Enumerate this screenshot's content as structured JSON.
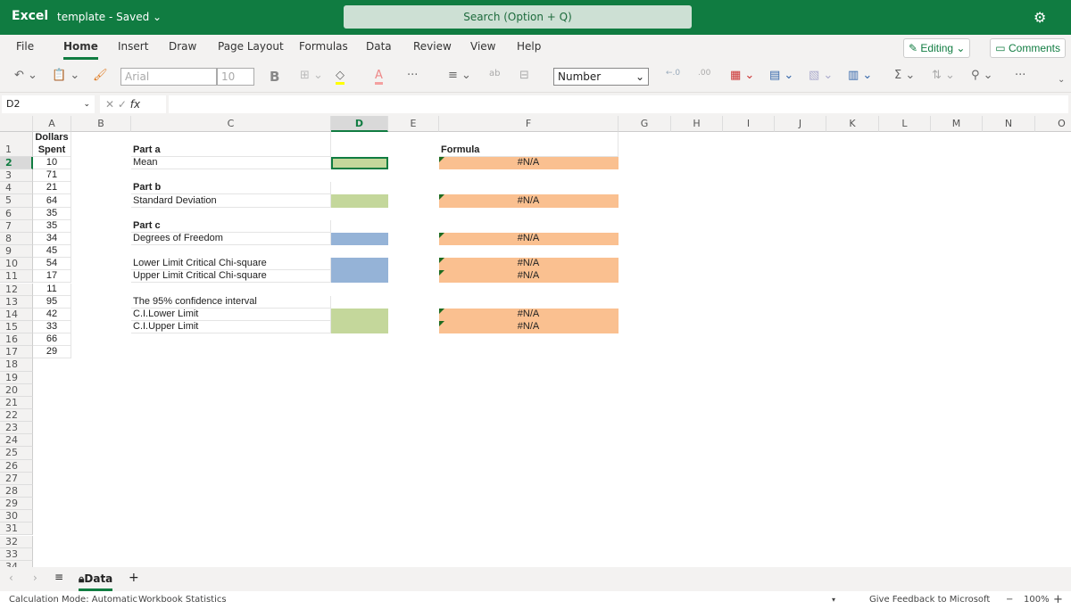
{
  "app": {
    "name": "Excel",
    "doc_title": "template",
    "doc_status": "Saved",
    "search_placeholder": "Search (Option + Q)"
  },
  "menu_tabs": [
    "File",
    "Home",
    "Insert",
    "Draw",
    "Page Layout",
    "Formulas",
    "Data",
    "Review",
    "View",
    "Help"
  ],
  "active_tab": "Home",
  "editing_label": "Editing",
  "comments_label": "Comments",
  "toolbar": {
    "font": "Arial",
    "size": "10",
    "bold": "B",
    "number_format": "Number"
  },
  "formula_bar": {
    "name_box": "D2",
    "fx": "fx",
    "value": ""
  },
  "columns": [
    "A",
    "B",
    "C",
    "D",
    "E",
    "F",
    "G",
    "H",
    "I",
    "J",
    "K",
    "L",
    "M",
    "N",
    "O"
  ],
  "selected_cell": "D2",
  "colors": {
    "brand": "#107c41",
    "green_fill": "#c4d79b",
    "blue_fill": "#95b3d7",
    "orange_fill": "#fac090"
  },
  "cells": {
    "A": {
      "1": "Dollars Spent",
      "2": "10",
      "3": "71",
      "4": "21",
      "5": "64",
      "6": "35",
      "7": "35",
      "8": "34",
      "9": "45",
      "10": "54",
      "11": "17",
      "12": "11",
      "13": "95",
      "14": "42",
      "15": "33",
      "16": "66",
      "17": "29"
    },
    "C": {
      "1": "Part a",
      "2": "Mean",
      "4": "Part b",
      "5": "Standard Deviation",
      "7": "Part c",
      "8": "Degrees of Freedom",
      "10": "Lower Limit Critical Chi-square",
      "11": "Upper Limit Critical Chi-square",
      "13": "The 95% confidence  interval",
      "14": "C.I.Lower Limit",
      "15": "C.I.Upper Limit"
    },
    "F": {
      "1": "Formula",
      "2": "#N/A",
      "5": "#N/A",
      "8": "#N/A",
      "10": "#N/A",
      "11": "#N/A",
      "14": "#N/A",
      "15": "#N/A"
    }
  },
  "sheet": {
    "name": "Data",
    "add": "+"
  },
  "status": {
    "calc_mode": "Calculation Mode: Automatic",
    "stats": "Workbook Statistics",
    "feedback": "Give Feedback to Microsoft",
    "zoom": "100%"
  }
}
